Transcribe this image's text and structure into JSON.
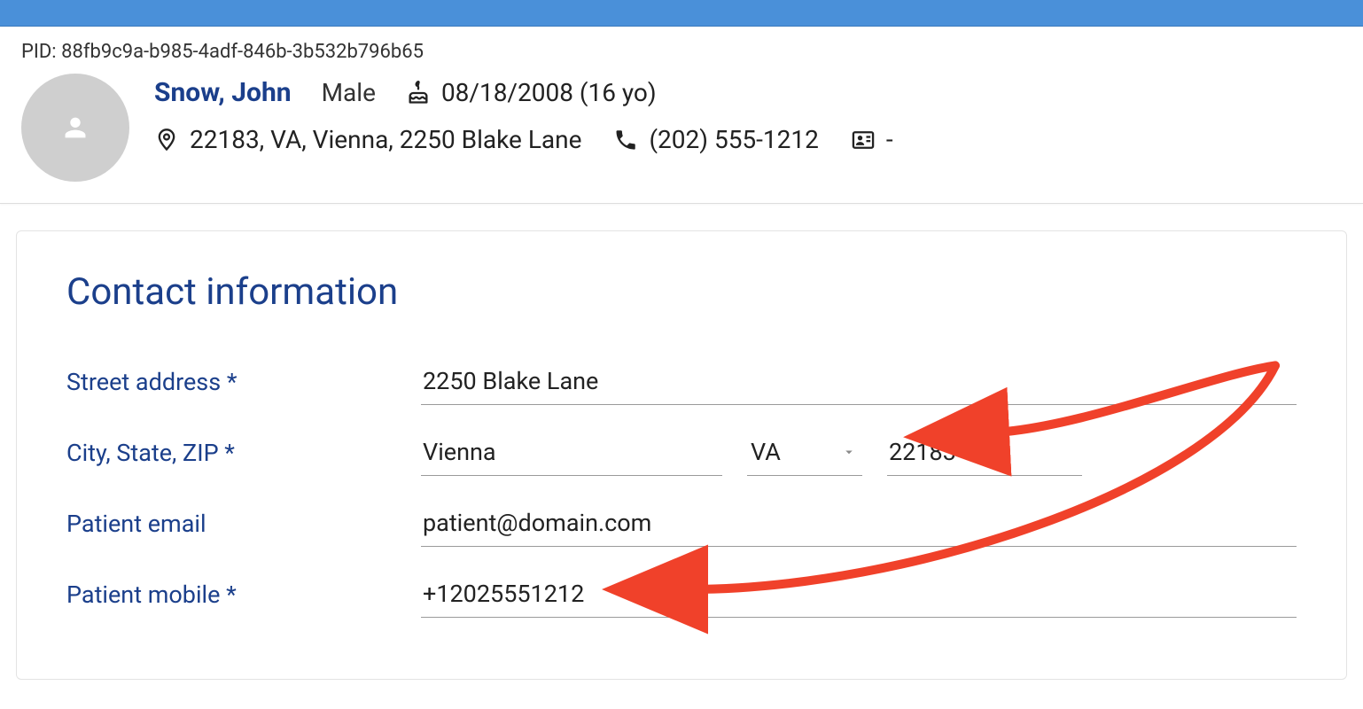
{
  "header": {
    "pid_label": "PID: ",
    "pid_value": "88fb9c9a-b985-4adf-846b-3b532b796b65",
    "patient_name": "Snow, John",
    "gender": "Male",
    "dob_display": "08/18/2008 (16 yo)",
    "address_display": "22183, VA, Vienna, 2250 Blake Lane",
    "phone_display": "(202) 555-1212",
    "contact_card_value": "-"
  },
  "section": {
    "title": "Contact information",
    "street_label": "Street address *",
    "city_state_zip_label": "City, State, ZIP *",
    "email_label": "Patient email",
    "mobile_label": "Patient mobile *"
  },
  "form": {
    "street": "2250 Blake Lane",
    "city": "Vienna",
    "state": "VA",
    "zip": "22183",
    "email": "patient@domain.com",
    "mobile": "+12025551212"
  }
}
